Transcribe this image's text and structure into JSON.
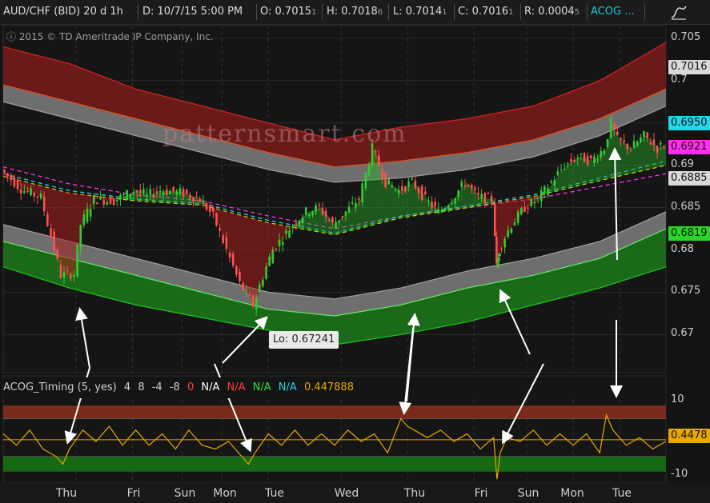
{
  "header": {
    "symbol": "AUD/CHF (BID) 20 d 1h",
    "date": "D: 10/7/15 5:00 PM",
    "open": "O: 0.7015",
    "open_sub": "1",
    "high": "H: 0.7018",
    "high_sub": "6",
    "low": "L: 0.7014",
    "low_sub": "1",
    "close": "C: 0.7016",
    "close_sub": "1",
    "range": "R: 0.0004",
    "range_sub": "5",
    "study": "ACOG ..."
  },
  "copyright": "2015 © TD Ameritrade IP Company, Inc.",
  "watermark": "patternsmart.com",
  "price_markers": [
    {
      "text": "0.7016",
      "value": 0.7016,
      "bg": "#d9d9d9",
      "fg": "#111111"
    },
    {
      "text": "0.6950",
      "value": 0.695,
      "bg": "#26d6ea",
      "fg": "#111111"
    },
    {
      "text": "0.6921",
      "value": 0.6921,
      "bg": "#ff2ef0",
      "fg": "#111111"
    },
    {
      "text": "0.6885",
      "value": 0.6885,
      "bg": "#d9d9d9",
      "fg": "#111111"
    },
    {
      "text": "0.6819",
      "value": 0.6819,
      "bg": "#27d627",
      "fg": "#111111"
    }
  ],
  "lo_callout": "Lo: 0.67241",
  "indicator": {
    "name": "ACOG_Timing (5, yes)",
    "params": [
      "4",
      "8",
      "-4",
      "-8"
    ],
    "zero": "0",
    "values": [
      {
        "text": "N/A",
        "color": "#ffffff"
      },
      {
        "text": "N/A",
        "color": "#ff3b3b"
      },
      {
        "text": "N/A",
        "color": "#33dd33"
      },
      {
        "text": "N/A",
        "color": "#26d6ea"
      }
    ],
    "current": "0.447888",
    "current_marker": "0.4478",
    "colors": {
      "line": "#e8a800",
      "upper_zone": "#7a2a18",
      "lower_zone": "#136a13",
      "mid_line": "#e8a800"
    }
  },
  "chart_data": [
    {
      "type": "line",
      "title": "AUD/CHF (BID) 20 d 1h",
      "x_tick_labels": [
        "Thu",
        "Fri",
        "Sun",
        "Mon",
        "Tue",
        "Wed",
        "Thu",
        "Fri",
        "Sun",
        "Mon",
        "Tue"
      ],
      "y_tick_labels": [
        "0.705",
        "0.7",
        "0.695",
        "0.69",
        "0.685",
        "0.68",
        "0.675",
        "0.67"
      ],
      "ylim": [
        0.6655,
        0.7065
      ],
      "xlim": [
        0,
        100
      ],
      "series": [
        {
          "role": "price",
          "color": "#33cc33",
          "x": [
            0,
            3,
            6,
            9,
            11,
            12,
            14,
            17,
            20,
            22,
            24,
            27,
            30,
            32,
            34,
            36,
            38,
            40,
            41,
            42,
            44,
            46,
            48,
            50,
            52,
            54,
            56,
            58,
            60,
            62,
            64,
            66,
            68,
            70,
            72,
            74,
            74.5,
            75,
            77,
            79,
            81,
            83,
            85,
            87,
            89,
            91,
            92,
            93,
            95,
            97,
            99,
            100
          ],
          "y": [
            0.6895,
            0.6872,
            0.6862,
            0.677,
            0.6772,
            0.683,
            0.686,
            0.6858,
            0.687,
            0.6865,
            0.687,
            0.6868,
            0.686,
            0.684,
            0.68,
            0.676,
            0.6735,
            0.678,
            0.68,
            0.681,
            0.683,
            0.6845,
            0.685,
            0.683,
            0.6845,
            0.686,
            0.692,
            0.688,
            0.687,
            0.688,
            0.686,
            0.6845,
            0.686,
            0.688,
            0.6862,
            0.686,
            0.678,
            0.68,
            0.683,
            0.685,
            0.686,
            0.688,
            0.69,
            0.691,
            0.6905,
            0.692,
            0.695,
            0.693,
            0.692,
            0.6935,
            0.692,
            0.6925
          ]
        },
        {
          "role": "upper-band-outer",
          "color": "#cc2222",
          "x": [
            0,
            10,
            20,
            30,
            40,
            50,
            60,
            70,
            80,
            90,
            100
          ],
          "y": [
            0.704,
            0.702,
            0.699,
            0.697,
            0.695,
            0.693,
            0.6945,
            0.6955,
            0.697,
            0.7,
            0.7045
          ]
        },
        {
          "role": "upper-band-inner",
          "color": "#e05020",
          "x": [
            0,
            10,
            20,
            30,
            40,
            50,
            60,
            70,
            80,
            90,
            100
          ],
          "y": [
            0.6995,
            0.6975,
            0.6955,
            0.6935,
            0.6915,
            0.6898,
            0.6905,
            0.6915,
            0.693,
            0.6955,
            0.699
          ]
        },
        {
          "role": "upper-band-grey",
          "color": "#9a9a9a",
          "x": [
            0,
            10,
            20,
            30,
            40,
            50,
            60,
            70,
            80,
            90,
            100
          ],
          "y": [
            0.6975,
            0.6955,
            0.6935,
            0.6915,
            0.6895,
            0.688,
            0.6885,
            0.6895,
            0.691,
            0.6935,
            0.697
          ]
        },
        {
          "role": "lower-band-grey",
          "color": "#9a9a9a",
          "x": [
            0,
            10,
            20,
            30,
            40,
            50,
            60,
            70,
            80,
            90,
            100
          ],
          "y": [
            0.683,
            0.681,
            0.679,
            0.677,
            0.675,
            0.6742,
            0.6755,
            0.6775,
            0.679,
            0.681,
            0.6845
          ]
        },
        {
          "role": "lower-band-inner",
          "color": "#66dd66",
          "x": [
            0,
            10,
            20,
            30,
            40,
            50,
            60,
            70,
            80,
            90,
            100
          ],
          "y": [
            0.681,
            0.679,
            0.677,
            0.675,
            0.673,
            0.6722,
            0.6735,
            0.6755,
            0.677,
            0.679,
            0.6825
          ]
        },
        {
          "role": "lower-band-outer",
          "color": "#22bb22",
          "x": [
            0,
            10,
            20,
            30,
            40,
            50,
            60,
            70,
            80,
            90,
            100
          ],
          "y": [
            0.678,
            0.6755,
            0.6735,
            0.672,
            0.6705,
            0.6688,
            0.67,
            0.6715,
            0.6735,
            0.6755,
            0.678
          ]
        },
        {
          "role": "ma-magenta",
          "color": "#ff33ee",
          "x": [
            0,
            10,
            20,
            30,
            40,
            50,
            60,
            70,
            80,
            90,
            100
          ],
          "y": [
            0.6898,
            0.6878,
            0.6865,
            0.6858,
            0.684,
            0.6825,
            0.684,
            0.685,
            0.686,
            0.6875,
            0.689
          ]
        },
        {
          "role": "ma-cyan",
          "color": "#26d6ea",
          "x": [
            0,
            10,
            20,
            30,
            40,
            50,
            60,
            70,
            80,
            90,
            100
          ],
          "y": [
            0.689,
            0.687,
            0.686,
            0.6855,
            0.6835,
            0.682,
            0.684,
            0.6852,
            0.6865,
            0.6885,
            0.6905
          ]
        },
        {
          "role": "ma-yellow",
          "color": "#e8e800",
          "x": [
            0,
            10,
            20,
            30,
            40,
            50,
            60,
            70,
            80,
            90,
            100
          ],
          "y": [
            0.6887,
            0.6867,
            0.6858,
            0.6853,
            0.6832,
            0.6818,
            0.6838,
            0.685,
            0.6863,
            0.6882,
            0.69
          ]
        }
      ]
    },
    {
      "type": "line",
      "title": "ACOG_Timing (5, yes)",
      "y_tick_labels": [
        "10",
        "-10"
      ],
      "ylim": [
        -11,
        11
      ],
      "series": [
        {
          "role": "oscillator",
          "color": "#e8a800",
          "x": [
            0,
            2,
            4,
            6,
            8,
            9,
            10,
            12,
            14,
            16,
            18,
            20,
            22,
            24,
            26,
            28,
            30,
            32,
            34,
            36,
            37,
            38,
            40,
            42,
            44,
            46,
            48,
            50,
            52,
            54,
            56,
            58,
            60,
            61,
            62,
            64,
            66,
            68,
            70,
            72,
            74,
            74.5,
            75,
            76,
            78,
            80,
            82,
            84,
            86,
            88,
            90,
            91,
            92,
            94,
            96,
            98,
            100
          ],
          "y": [
            2,
            -1,
            3,
            -2,
            -4,
            -6,
            -2,
            3,
            0,
            4,
            -1,
            3,
            -1,
            2,
            -2,
            3,
            -1,
            -2,
            0,
            -4,
            -6,
            -3,
            2,
            -1,
            3,
            -1,
            2,
            -1,
            3,
            0,
            2,
            -3,
            6,
            4,
            3,
            1,
            3,
            0,
            2,
            -2,
            1,
            -10,
            -3,
            1,
            0,
            3,
            -1,
            2,
            -1,
            2,
            -3,
            7,
            3,
            -1,
            1,
            -2,
            0
          ]
        }
      ]
    }
  ]
}
